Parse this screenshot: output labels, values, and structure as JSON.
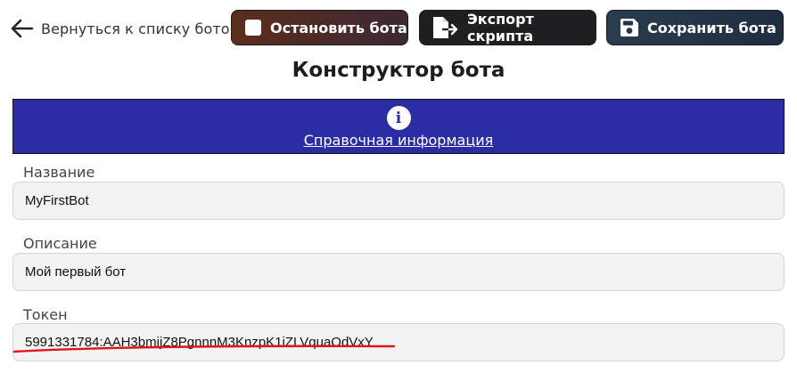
{
  "toolbar": {
    "back_label": "Вернуться к списку ботов",
    "stop_label": "Остановить бота",
    "export_label": "Экспорт скрипта",
    "save_label": "Сохранить бота",
    "icons": {
      "back": "arrow-left-icon",
      "stop": "stop-square-icon",
      "export": "file-export-icon",
      "save": "floppy-disk-icon"
    }
  },
  "page": {
    "title": "Конструктор бота"
  },
  "info_banner": {
    "icon": "info-circle-icon",
    "link_label": "Справочная информация",
    "background": "#2b2da5"
  },
  "form": {
    "name": {
      "label": "Название",
      "value": "MyFirstBot"
    },
    "description": {
      "label": "Описание",
      "value": "Мой первый бот"
    },
    "token": {
      "label": "Токен",
      "value": "5991331784:AAH3bmijZ8PgnnnM3KnzpK1iZLVquaOdVxY"
    }
  },
  "annotation": {
    "underline_color": "#e0141c"
  }
}
